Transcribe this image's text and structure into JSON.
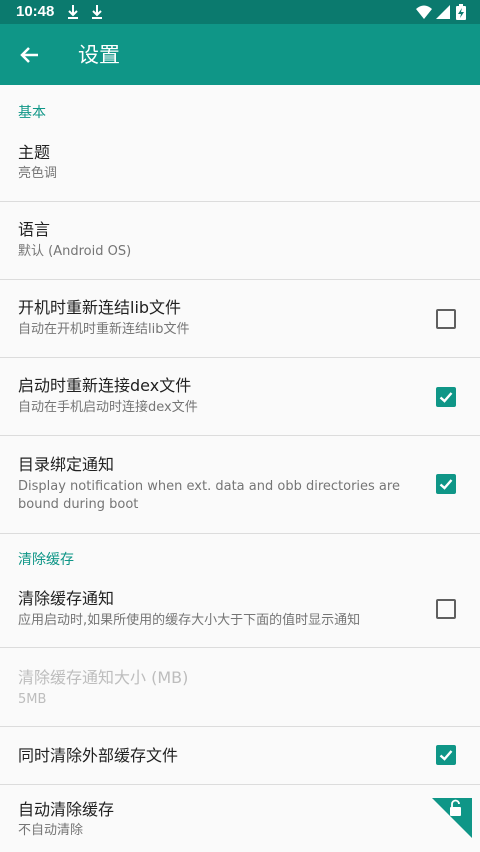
{
  "status_bar": {
    "time": "10:48"
  },
  "toolbar": {
    "title": "设置"
  },
  "sections": {
    "basic": "基本",
    "clear_cache": "清除缓存"
  },
  "prefs": {
    "theme": {
      "title": "主题",
      "summary": "亮色调"
    },
    "language": {
      "title": "语言",
      "summary": "默认 (Android OS)"
    },
    "relink_lib": {
      "title": "开机时重新连结lib文件",
      "summary": "自动在开机时重新连结lib文件",
      "checked": false
    },
    "relink_dex": {
      "title": "启动时重新连接dex文件",
      "summary": "自动在手机启动时连接dex文件",
      "checked": true
    },
    "bind_notify": {
      "title": "目录绑定通知",
      "summary": "Display notification when ext. data and obb directories are bound during boot",
      "checked": true
    },
    "cache_notify": {
      "title": "清除缓存通知",
      "summary": "应用启动时,如果所使用的缓存大小大于下面的值时显示通知",
      "checked": false
    },
    "cache_notify_size": {
      "title": "清除缓存通知大小 (MB)",
      "summary": "5MB"
    },
    "clear_external": {
      "title": "同时清除外部缓存文件",
      "checked": true
    },
    "auto_clear": {
      "title": "自动清除缓存",
      "summary": "不自动清除"
    }
  },
  "colors": {
    "status_bar": "#0b7a6e",
    "toolbar": "#0f9687",
    "accent": "#0f9687"
  },
  "icons": {
    "back": "arrow-back-icon",
    "download": "download-icon",
    "wifi": "wifi-icon",
    "signal": "signal-icon",
    "battery": "battery-charging-icon",
    "checkmark": "checkmark-icon",
    "unlock": "unlock-icon"
  }
}
